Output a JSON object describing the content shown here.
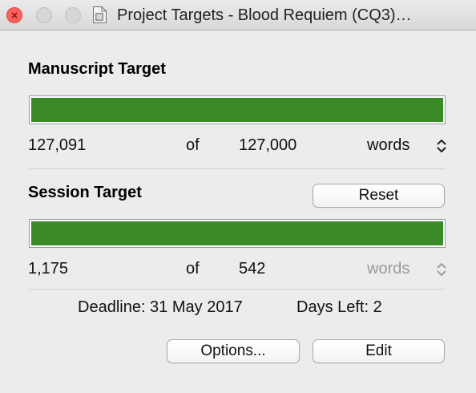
{
  "window": {
    "title": "Project Targets - Blood Requiem (CQ3)…"
  },
  "manuscript": {
    "heading": "Manuscript Target",
    "current": "127,091",
    "of_label": "of",
    "target": "127,000",
    "unit": "words",
    "progress_fraction": 1.0
  },
  "session": {
    "heading": "Session Target",
    "reset_label": "Reset",
    "current": "1,175",
    "of_label": "of",
    "target": "542",
    "unit": "words",
    "progress_fraction": 1.0
  },
  "info": {
    "deadline": "Deadline: 31 May 2017",
    "days_left": "Days Left: 2"
  },
  "buttons": {
    "options_label": "Options...",
    "edit_label": "Edit"
  },
  "colors": {
    "progress_fill": "#3a8a26",
    "close_button": "#fc605b"
  },
  "icons": {
    "document": "document-icon",
    "stepper": "stepper-icon"
  }
}
